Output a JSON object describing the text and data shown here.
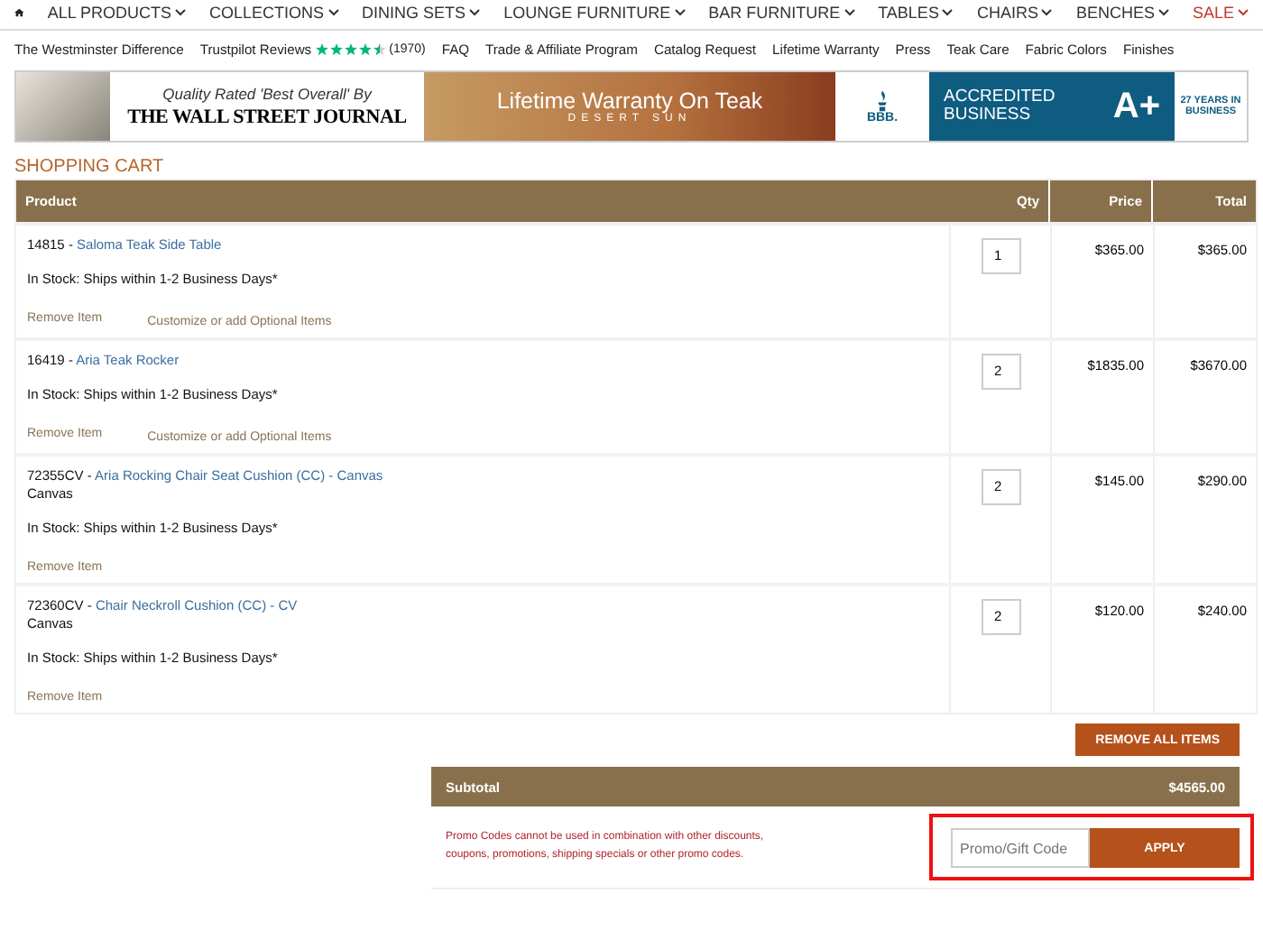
{
  "main_nav": [
    {
      "label": "ALL PRODUCTS",
      "kind": "menu"
    },
    {
      "label": "COLLECTIONS",
      "kind": "menu"
    },
    {
      "label": "DINING SETS",
      "kind": "menu"
    },
    {
      "label": "LOUNGE FURNITURE",
      "kind": "menu"
    },
    {
      "label": "BAR FURNITURE",
      "kind": "menu"
    },
    {
      "label": "TABLES",
      "kind": "menu"
    },
    {
      "label": "CHAIRS",
      "kind": "menu"
    },
    {
      "label": "BENCHES",
      "kind": "menu"
    },
    {
      "label": "SALE",
      "kind": "sale"
    }
  ],
  "sub_nav": [
    {
      "label": "The Westminster Difference"
    },
    {
      "label": "Trustpilot Reviews",
      "stars": 4.5,
      "count": "(1970)"
    },
    {
      "label": "FAQ"
    },
    {
      "label": "Trade & Affiliate Program"
    },
    {
      "label": "Catalog Request"
    },
    {
      "label": "Lifetime Warranty"
    },
    {
      "label": "Press"
    },
    {
      "label": "Teak Care"
    },
    {
      "label": "Fabric Colors"
    },
    {
      "label": "Finishes"
    }
  ],
  "banner": {
    "wsj_tagline": "Quality Rated 'Best Overall' By",
    "wsj_name": "THE WALL STREET JOURNAL",
    "warranty_title": "Lifetime Warranty On Teak",
    "warranty_subtitle": "DESERT SUN",
    "bbb_label": "BBB.",
    "accredited": "ACCREDITED BUSINESS",
    "rating": "A+",
    "years": "27 YEARS IN BUSINESS"
  },
  "cart": {
    "title": "SHOPPING CART",
    "columns": [
      "Product",
      "Qty",
      "Price",
      "Total"
    ],
    "rows": [
      {
        "sku": "14815 -",
        "name": "Saloma Teak Side Table",
        "option": null,
        "stock": "In Stock: Ships within 1-2 Business Days*",
        "remove": "Remove Item",
        "customize": "Customize",
        "customize_rest": "or add Optional Items",
        "qty": "1",
        "price": "$365.00",
        "total": "$365.00"
      },
      {
        "sku": "16419 -",
        "name": "Aria Teak Rocker",
        "option": null,
        "stock": "In Stock: Ships within 1-2 Business Days*",
        "remove": "Remove Item",
        "customize": "Customize",
        "customize_rest": "or add Optional Items",
        "qty": "2",
        "price": "$1835.00",
        "total": "$3670.00"
      },
      {
        "sku": "72355CV -",
        "name": "Aria Rocking Chair Seat Cushion (CC) - Canvas",
        "option": "Canvas",
        "stock": "In Stock: Ships within 1-2 Business Days*",
        "remove": "Remove Item",
        "qty": "2",
        "price": "$145.00",
        "total": "$290.00"
      },
      {
        "sku": "72360CV -",
        "name": "Chair Neckroll Cushion (CC) - CV",
        "option": "Canvas",
        "stock": "In Stock: Ships within 1-2 Business Days*",
        "remove": "Remove Item",
        "qty": "2",
        "price": "$120.00",
        "total": "$240.00"
      }
    ],
    "remove_all": "REMOVE ALL ITEMS",
    "subtotal_label": "Subtotal",
    "subtotal": "$4565.00",
    "promo_note": "Promo Codes cannot be used in combination with other discounts, coupons, promotions, shipping specials or other promo codes.",
    "promo_placeholder": "Promo/Gift Code",
    "apply": "APPLY"
  }
}
